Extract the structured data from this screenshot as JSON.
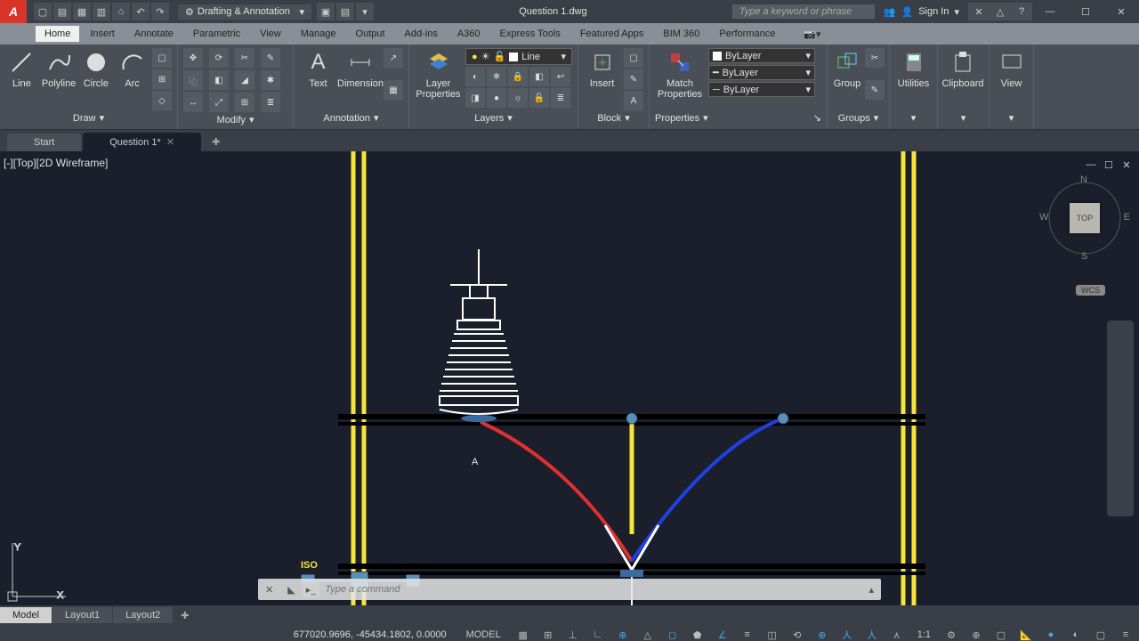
{
  "title": "Question 1.dwg",
  "workspace": "Drafting & Annotation",
  "search_placeholder": "Type a keyword or phrase",
  "signin": "Sign In",
  "menus": [
    "Home",
    "Insert",
    "Annotate",
    "Parametric",
    "View",
    "Manage",
    "Output",
    "Add-ins",
    "A360",
    "Express Tools",
    "Featured Apps",
    "BIM 360",
    "Performance"
  ],
  "active_menu": "Home",
  "ribbon": {
    "draw": {
      "label": "Draw",
      "items": [
        "Line",
        "Polyline",
        "Circle",
        "Arc"
      ]
    },
    "modify": {
      "label": "Modify"
    },
    "annotation": {
      "label": "Annotation",
      "items": [
        "Text",
        "Dimension"
      ]
    },
    "layers": {
      "label": "Layers",
      "btn": "Layer\nProperties",
      "current": "Line"
    },
    "block": {
      "label": "Block",
      "btn": "Insert"
    },
    "properties": {
      "label": "Properties",
      "btn": "Match\nProperties",
      "vals": [
        "ByLayer",
        "ByLayer",
        "ByLayer"
      ]
    },
    "groups": {
      "label": "Groups",
      "btn": "Group"
    },
    "utilities": {
      "label": "Utilities"
    },
    "clipboard": {
      "label": "Clipboard"
    },
    "view": {
      "label": "View"
    }
  },
  "filetabs": {
    "start": "Start",
    "active": "Question 1*"
  },
  "viewport_label": "[-][Top][2D Wireframe]",
  "viewcube": {
    "face": "TOP",
    "n": "N",
    "s": "S",
    "e": "E",
    "w": "W",
    "wcs": "WCS"
  },
  "drawing": {
    "label_A": "A",
    "label_ISO": "ISO"
  },
  "cmd_placeholder": "Type a command",
  "layout_tabs": [
    "Model",
    "Layout1",
    "Layout2"
  ],
  "status": {
    "coords": "677020.9696, -45434.1802, 0.0000",
    "space": "MODEL",
    "scale": "1:1"
  }
}
